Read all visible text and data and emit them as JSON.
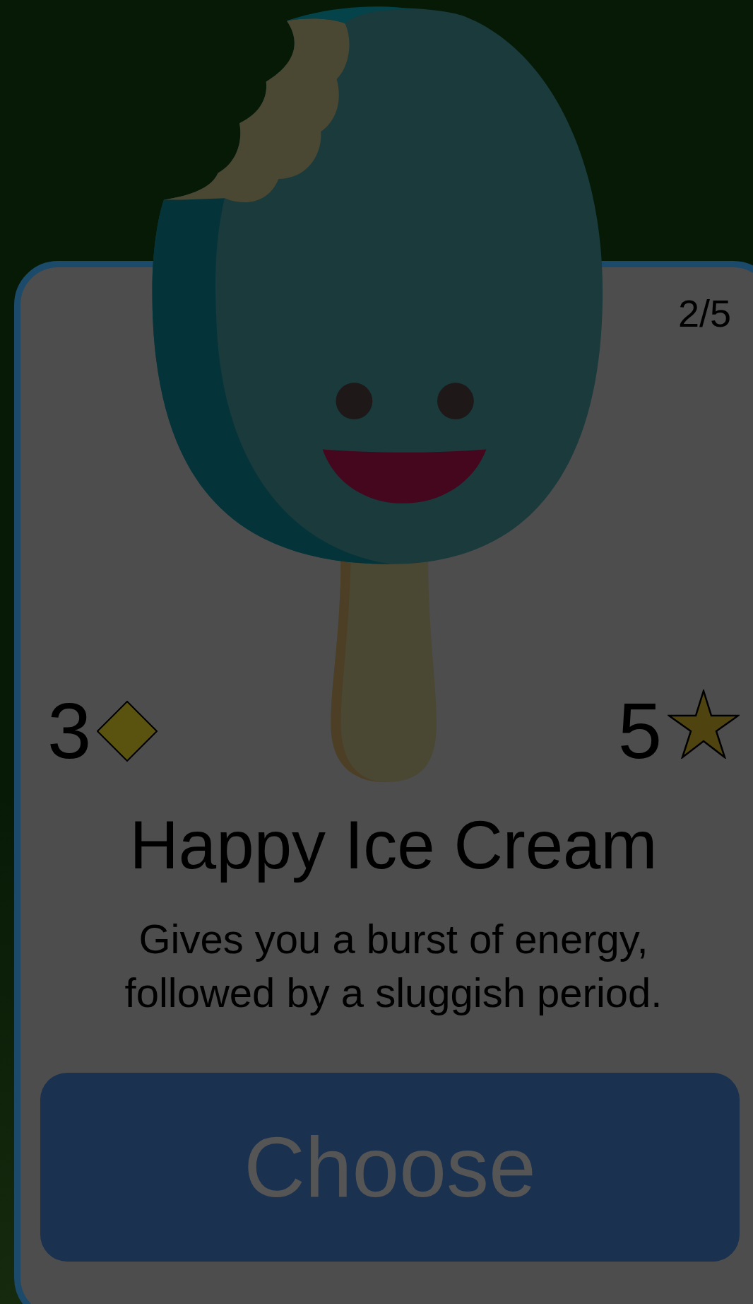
{
  "counter": "2/5",
  "cost": "3",
  "rating": "5",
  "title": "Happy Ice Cream",
  "description": "Gives you a burst of energy, followed by a sluggish period.",
  "button": "Choose"
}
